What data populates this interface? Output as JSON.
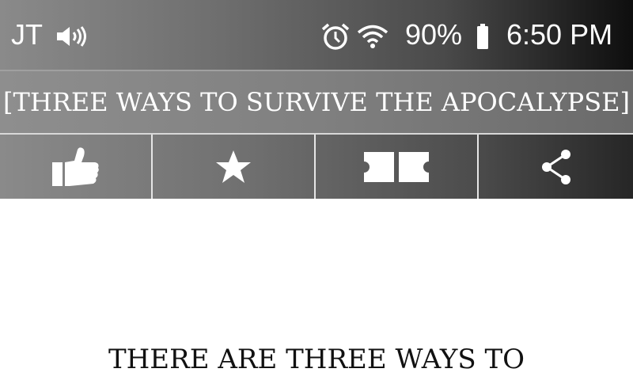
{
  "status_bar": {
    "carrier": "JT",
    "battery_percent": "90%",
    "time": "6:50 PM",
    "icons": [
      "volume-icon",
      "alarm-icon",
      "wifi-icon",
      "battery-icon"
    ]
  },
  "title_bar": {
    "title": "[THREE WAYS TO SURVIVE THE APOCALYPSE]"
  },
  "toolbar": {
    "buttons": [
      {
        "icon": "thumbs-up-icon"
      },
      {
        "icon": "star-icon"
      },
      {
        "icon": "ticket-icon"
      },
      {
        "icon": "share-icon"
      }
    ]
  },
  "content": {
    "text": "THERE ARE THREE WAYS TO"
  },
  "colors": {
    "bar_dark": "#0e0e0e",
    "bar_light": "#8a8a8a",
    "foreground": "#ffffff",
    "content_text": "#111111"
  }
}
